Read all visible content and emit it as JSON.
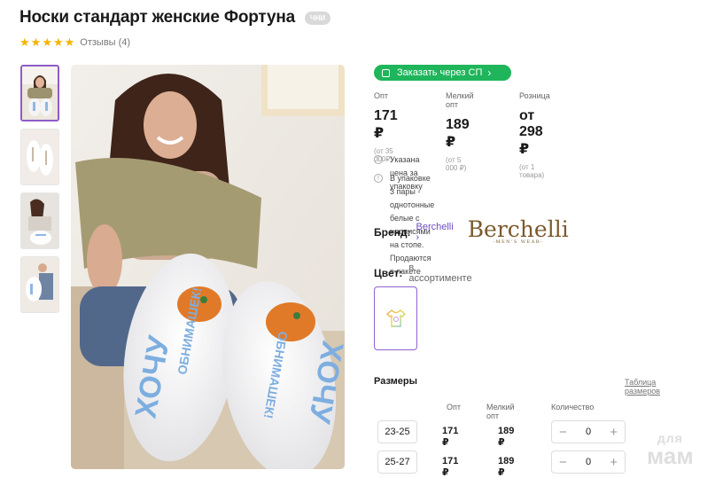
{
  "product": {
    "title": "Носки стандарт женские Фортуна",
    "badge": "ЧНИ",
    "rating_stars": 5,
    "reviews_label": "Отзывы (4)"
  },
  "order_button": {
    "label": "Заказать через СП"
  },
  "prices": [
    {
      "label": "Опт",
      "value": "171 ₽",
      "sub": "(от 35 000₽)"
    },
    {
      "label": "Мелкий опт",
      "value": "189 ₽",
      "sub": "(от 5 000 ₽)"
    },
    {
      "label": "Розница",
      "value": "от 298 ₽",
      "sub": "(от 1 товара)"
    }
  ],
  "notes": {
    "price_note": "Указана цена за упаковку",
    "pack_note_line1": "В упаковке 3 пары - однотонные белые с надписями на стопе.",
    "pack_note_line2": "Продаются в пакете"
  },
  "brand": {
    "label": "Бренд:",
    "name": "Berchelli",
    "logo_main": "Berchelli",
    "logo_sub": "-MEN'S WEAR-"
  },
  "color": {
    "label": "Цвет:",
    "value": "в ассортименте"
  },
  "sizes": {
    "title": "Размеры",
    "table_link": "Таблица размеров",
    "headers": {
      "opt": "Опт",
      "small_opt": "Мелкий опт",
      "qty": "Количество"
    },
    "rows": [
      {
        "size": "23-25",
        "opt": "171 ₽",
        "small_opt": "189 ₽",
        "qty": "0"
      },
      {
        "size": "25-27",
        "opt": "171 ₽",
        "small_opt": "189 ₽",
        "qty": "0"
      }
    ]
  },
  "photo_text": {
    "sock_word_1": "ХОЧУ",
    "sock_word_2": "ОБНИМАШЕК!"
  },
  "watermark": {
    "top": "для",
    "bottom": "мам"
  },
  "colors": {
    "accent_green": "#1fb55b",
    "brand_purple": "#6d4bbf",
    "star": "#f6b400"
  }
}
